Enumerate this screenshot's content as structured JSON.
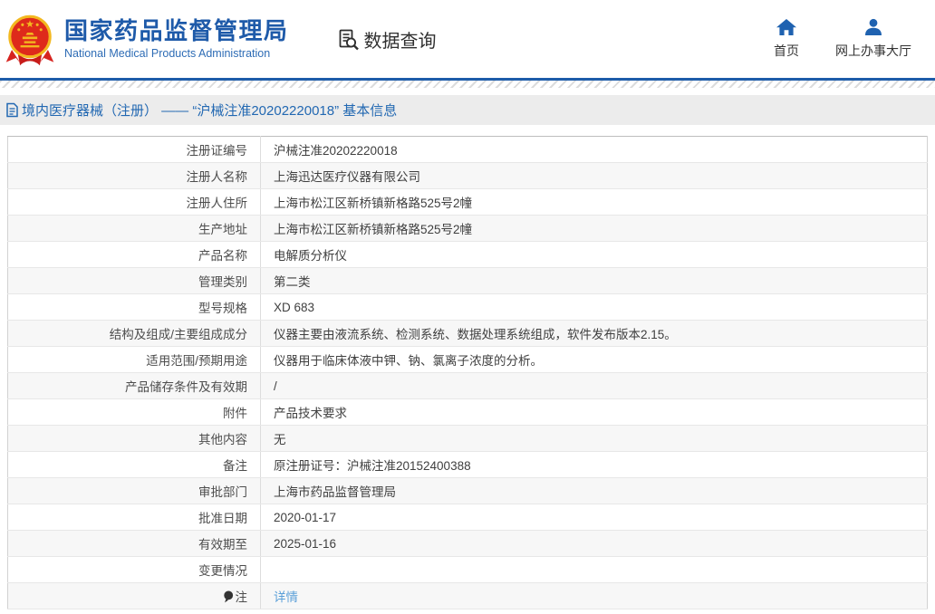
{
  "header": {
    "agency_name_cn": "国家药品监督管理局",
    "agency_name_en": "National Medical Products Administration",
    "data_query_label": "数据查询",
    "nav": [
      {
        "label": "首页",
        "icon": "home-icon"
      },
      {
        "label": "网上办事大厅",
        "icon": "user-icon"
      }
    ]
  },
  "breadcrumb": {
    "text": "境内医疗器械（注册） —— “沪械注准20202220018” 基本信息"
  },
  "table": {
    "rows": [
      {
        "label": "注册证编号",
        "value": "沪械注准20202220018"
      },
      {
        "label": "注册人名称",
        "value": "上海迅达医疗仪器有限公司"
      },
      {
        "label": "注册人住所",
        "value": "上海市松江区新桥镇新格路525号2幢"
      },
      {
        "label": "生产地址",
        "value": "上海市松江区新桥镇新格路525号2幢"
      },
      {
        "label": "产品名称",
        "value": "电解质分析仪"
      },
      {
        "label": "管理类别",
        "value": "第二类"
      },
      {
        "label": "型号规格",
        "value": "XD 683"
      },
      {
        "label": "结构及组成/主要组成成分",
        "value": "仪器主要由液流系统、检测系统、数据处理系统组成，软件发布版本2.15。"
      },
      {
        "label": "适用范围/预期用途",
        "value": "仪器用于临床体液中钾、钠、氯离子浓度的分析。"
      },
      {
        "label": "产品储存条件及有效期",
        "value": "/"
      },
      {
        "label": "附件",
        "value": "产品技术要求"
      },
      {
        "label": "其他内容",
        "value": "无"
      },
      {
        "label": "备注",
        "value": "原注册证号：沪械注准20152400388"
      },
      {
        "label": "审批部门",
        "value": "上海市药品监督管理局"
      },
      {
        "label": "批准日期",
        "value": "2020-01-17"
      },
      {
        "label": "有效期至",
        "value": "2025-01-16"
      },
      {
        "label": "变更情况",
        "value": ""
      },
      {
        "label": "注",
        "label_icon": "balloon-icon",
        "value": "详情",
        "value_is_link": true
      }
    ]
  },
  "colors": {
    "brand_blue": "#1e5aa9",
    "nav_icon_blue": "#1f62b0",
    "breadcrumb_text": "#2268b2",
    "link_blue": "#5a9fd8",
    "header_rule_blue": "#1d5ca9",
    "row_stripe": "#f7f7f7",
    "emblem_red": "#de2a1b",
    "emblem_gold": "#f3b81f"
  }
}
